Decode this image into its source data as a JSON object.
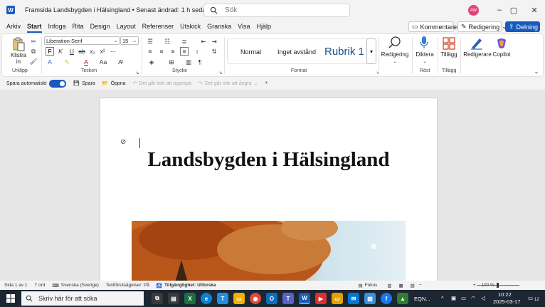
{
  "titlebar": {
    "app_logo": "W",
    "doc_title": "Framsida Landsbygden i Hälsingland • Senast ändrad: 1 h sedan",
    "search_placeholder": "Sök",
    "avatar_initials": "AW"
  },
  "menu": {
    "tabs": [
      "Arkiv",
      "Start",
      "Infoga",
      "Rita",
      "Design",
      "Layout",
      "Referenser",
      "Utskick",
      "Granska",
      "Visa",
      "Hjälp"
    ],
    "active_tab": "Start",
    "comments_label": "Kommentarer",
    "editing_label": "Redigering",
    "share_label": "Delning"
  },
  "ribbon": {
    "paste_label": "Klistra in",
    "font_name": "Liberation Serif",
    "font_size": "15",
    "groups": {
      "clipboard": "Urklipp",
      "font": "Tecken",
      "paragraph": "Stycke",
      "styles": "Format",
      "voice": "Röst",
      "addins": "Tillägg"
    },
    "styles": [
      "Normal",
      "Inget avstånd",
      "Rubrik 1"
    ],
    "editing_label": "Redigering",
    "dictate_label": "Diktera",
    "addins_label": "Tillägg",
    "editor_label": "Redigerare",
    "copilot_label": "Copilot"
  },
  "qat": {
    "autosave_label": "Spara automatiskt",
    "save_label": "Spara",
    "open_label": "Öppna",
    "undo_label": "Det går inte att upprepa",
    "redo_label": "Det går inte att ångra"
  },
  "document": {
    "heading": "Landsbygden i Hälsingland"
  },
  "statusbar": {
    "page": "Sida 1 av 1",
    "words": "7 ord",
    "language": "Svenska (Sverige)",
    "predictions": "Textförutsägelser: På",
    "accessibility": "Tillgänglighet: Utforska",
    "focus": "Fokus",
    "zoom": "100 %"
  },
  "taskbar": {
    "search_placeholder": "Skriv här för att söka",
    "ticker": "EQN...",
    "time": "10:22",
    "date": "2025-03-17",
    "notifications": "12"
  },
  "colors": {
    "accent": "#185abd",
    "taskbar": "#1d2633"
  }
}
